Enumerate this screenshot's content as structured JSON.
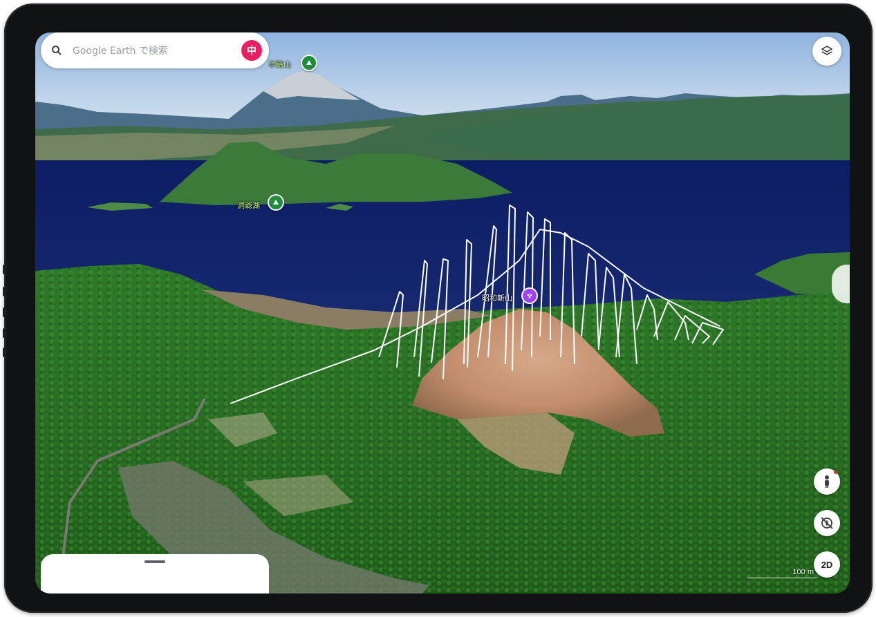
{
  "search": {
    "placeholder": "Google Earth で検索"
  },
  "account": {
    "initial": "中"
  },
  "labels": {
    "mountain": "羊蹄山",
    "lake": "洞爺湖",
    "poi": "昭和新山"
  },
  "controls": {
    "view_mode": "2D",
    "scale": "100 m"
  },
  "icons": {
    "search": "search-icon",
    "layers": "layers-icon",
    "pegman": "pegman-icon",
    "compass": "compass-reset-icon",
    "tree": "tree-icon",
    "poi": "poi-icon"
  },
  "colors": {
    "avatar": "#e91e63",
    "pin_green": "#1e8e3e",
    "pin_purple": "#a142f4",
    "lake": "#0f1f64",
    "forest": "#2f6b22",
    "sky": "#bfd8ee"
  }
}
